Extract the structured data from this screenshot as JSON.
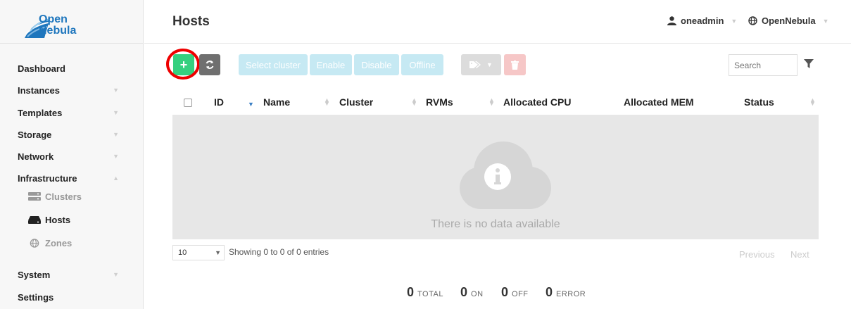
{
  "brand": {
    "line1": "Open",
    "line2": "Nebula",
    "color": "#1e76bd"
  },
  "sidebar": {
    "items": [
      {
        "label": "Dashboard"
      },
      {
        "label": "Instances"
      },
      {
        "label": "Templates"
      },
      {
        "label": "Storage"
      },
      {
        "label": "Network"
      },
      {
        "label": "Infrastructure"
      }
    ],
    "sub_items": [
      {
        "label": "Clusters",
        "icon": "server-icon"
      },
      {
        "label": "Hosts",
        "icon": "hdd-icon"
      },
      {
        "label": "Zones",
        "icon": "globe-icon"
      }
    ],
    "bottom_items": [
      {
        "label": "System"
      },
      {
        "label": "Settings"
      }
    ]
  },
  "header": {
    "title": "Hosts",
    "user": "oneadmin",
    "zone": "OpenNebula"
  },
  "toolbar": {
    "create_label": "+",
    "buttons": [
      {
        "label": "Select cluster"
      },
      {
        "label": "Enable"
      },
      {
        "label": "Disable"
      },
      {
        "label": "Offline"
      }
    ],
    "search_placeholder": "Search",
    "colors": {
      "create": "#35d07f",
      "refresh": "#6f6f6f",
      "light": "#c6e9f3",
      "delete": "#f6c7c7",
      "highlight": "#ee0000"
    }
  },
  "table": {
    "columns": [
      "ID",
      "Name",
      "Cluster",
      "RVMs",
      "Allocated CPU",
      "Allocated MEM",
      "Status"
    ],
    "empty_message": "There is no data available"
  },
  "footer": {
    "page_length": "10",
    "info": "Showing 0 to 0 of 0 entries",
    "previous": "Previous",
    "next": "Next"
  },
  "stats": [
    {
      "value": "0",
      "label": "TOTAL"
    },
    {
      "value": "0",
      "label": "ON"
    },
    {
      "value": "0",
      "label": "OFF"
    },
    {
      "value": "0",
      "label": "ERROR"
    }
  ]
}
